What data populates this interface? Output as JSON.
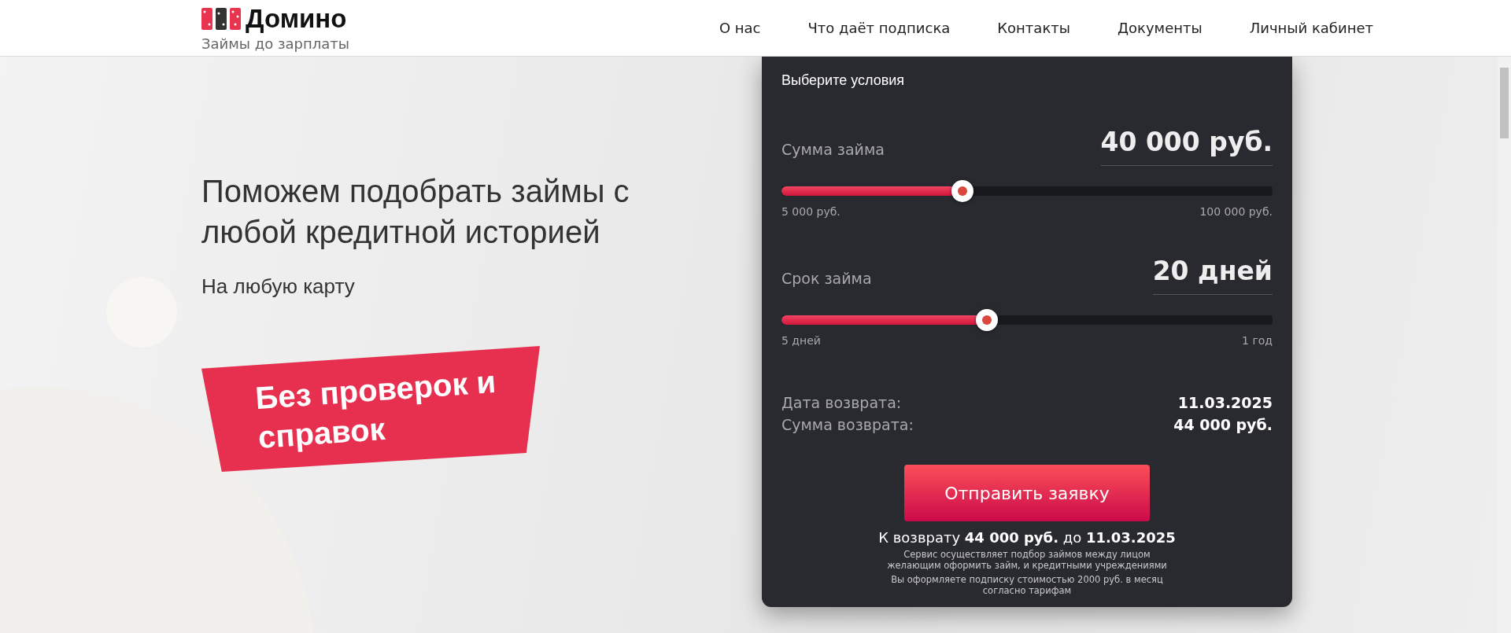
{
  "header": {
    "logo_text": "Домино",
    "tagline": "Займы до зарплаты",
    "nav": [
      {
        "label": "О нас"
      },
      {
        "label": "Что даёт подписка"
      },
      {
        "label": "Контакты"
      },
      {
        "label": "Документы"
      },
      {
        "label": "Личный кабинет"
      }
    ]
  },
  "hero": {
    "title": "Поможем подобрать займы с любой кредитной историей",
    "subtitle": "На любую карту",
    "banner": "Без проверок и справок"
  },
  "calculator": {
    "title": "Выберите условия",
    "sliders": [
      {
        "label": "Сумма займа",
        "value": "40 000 руб.",
        "level": 0.369,
        "min_label": "5 000 руб.",
        "max_label": "100 000 руб."
      },
      {
        "label": "Срок займа",
        "value": "20 дней",
        "level": 0.418,
        "min_label": "5 дней",
        "max_label": "1 год"
      }
    ],
    "summary": [
      {
        "label": "Дата возврата:",
        "value": "11.03.2025"
      },
      {
        "label": "Сумма возврата:",
        "value": "44 000 руб."
      }
    ],
    "submit": "Отправить заявку",
    "total": "К возврату **44 000 руб.** до **11.03.2025**",
    "notes": [
      "Сервис осуществляет подбор займов между лицом желающим оформить займ, и кредитными учреждениями",
      "Вы оформляете подписку стоимостью 2000 руб. в месяц согласно тарифам"
    ]
  }
}
